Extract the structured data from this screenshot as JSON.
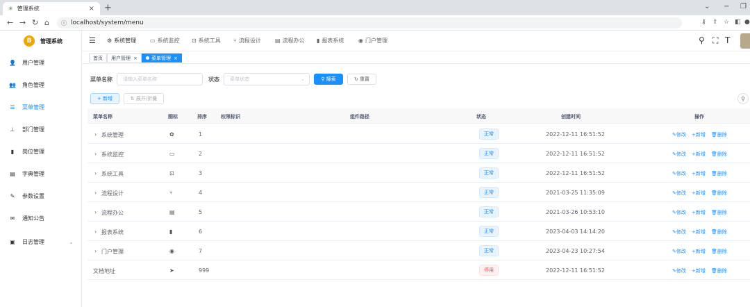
{
  "browser": {
    "tab_title": "管理系统",
    "url": "localhost/system/menu"
  },
  "app": {
    "logo_glyph": "B",
    "title": "管理系统"
  },
  "sidebar": {
    "items": [
      {
        "label": "用户管理",
        "icon": "user-icon",
        "glyph": "👤"
      },
      {
        "label": "角色管理",
        "icon": "role-icon",
        "glyph": "👥"
      },
      {
        "label": "菜单管理",
        "icon": "tree-table-icon",
        "glyph": "☰"
      },
      {
        "label": "部门管理",
        "icon": "tree-icon",
        "glyph": "⊥"
      },
      {
        "label": "岗位管理",
        "icon": "post-icon",
        "glyph": "▮"
      },
      {
        "label": "字典管理",
        "icon": "dict-icon",
        "glyph": "▤"
      },
      {
        "label": "参数设置",
        "icon": "edit-icon",
        "glyph": "✎"
      },
      {
        "label": "通知公告",
        "icon": "message-icon",
        "glyph": "✉"
      },
      {
        "label": "日志管理",
        "icon": "log-icon",
        "glyph": "▣"
      }
    ]
  },
  "topnav": {
    "items": [
      {
        "label": "系统管理",
        "glyph": "⚙"
      },
      {
        "label": "系统监控",
        "glyph": "▭"
      },
      {
        "label": "系统工具",
        "glyph": "⊡"
      },
      {
        "label": "流程设计",
        "glyph": "⑂"
      },
      {
        "label": "流程办公",
        "glyph": "▤"
      },
      {
        "label": "报表系统",
        "glyph": "▮"
      },
      {
        "label": "门户管理",
        "glyph": "◉"
      }
    ]
  },
  "tags": [
    {
      "label": "首页"
    },
    {
      "label": "用户管理"
    },
    {
      "label": "菜单管理"
    }
  ],
  "search": {
    "name_label": "菜单名称",
    "name_placeholder": "请输入菜单名称",
    "status_label": "状态",
    "status_placeholder": "菜单状态",
    "search_btn": "搜索",
    "reset_btn": "重置"
  },
  "toolbar": {
    "add_btn": "新增",
    "expand_btn": "展开/折叠"
  },
  "table": {
    "headers": {
      "name": "菜单名称",
      "icon": "图标",
      "order": "排序",
      "perms": "权限标识",
      "component": "组件路径",
      "status": "状态",
      "created": "创建时间",
      "ops": "操作"
    },
    "actions": {
      "edit": "修改",
      "add": "新增",
      "del": "删除"
    },
    "rows": [
      {
        "name": "系统管理",
        "expandable": true,
        "icon": "gear-icon",
        "glyph": "✿",
        "order": "1",
        "status": "正常",
        "status_type": "normal",
        "created": "2022-12-11 16:51:52"
      },
      {
        "name": "系统监控",
        "expandable": true,
        "icon": "monitor-icon",
        "glyph": "▭",
        "order": "2",
        "status": "正常",
        "status_type": "normal",
        "created": "2022-12-11 16:51:52"
      },
      {
        "name": "系统工具",
        "expandable": true,
        "icon": "tool-icon",
        "glyph": "⊡",
        "order": "3",
        "status": "正常",
        "status_type": "normal",
        "created": "2022-12-11 16:51:52"
      },
      {
        "name": "流程设计",
        "expandable": true,
        "icon": "flow-icon",
        "glyph": "⑂",
        "order": "4",
        "status": "正常",
        "status_type": "normal",
        "created": "2021-03-25 11:35:09"
      },
      {
        "name": "流程办公",
        "expandable": true,
        "icon": "office-icon",
        "glyph": "▤",
        "order": "5",
        "status": "正常",
        "status_type": "normal",
        "created": "2021-03-26 10:53:10"
      },
      {
        "name": "报表系统",
        "expandable": true,
        "icon": "chart-icon",
        "glyph": "▮",
        "order": "6",
        "status": "正常",
        "status_type": "normal",
        "created": "2023-04-03 14:14:20"
      },
      {
        "name": "门户管理",
        "expandable": true,
        "icon": "dashboard-icon",
        "glyph": "◉",
        "order": "7",
        "status": "正常",
        "status_type": "normal",
        "created": "2023-04-23 10:27:54"
      },
      {
        "name": "文档地址",
        "expandable": false,
        "icon": "send-icon",
        "glyph": "➤",
        "order": "999",
        "status": "停用",
        "status_type": "danger",
        "created": "2022-12-11 16:51:52"
      }
    ]
  }
}
